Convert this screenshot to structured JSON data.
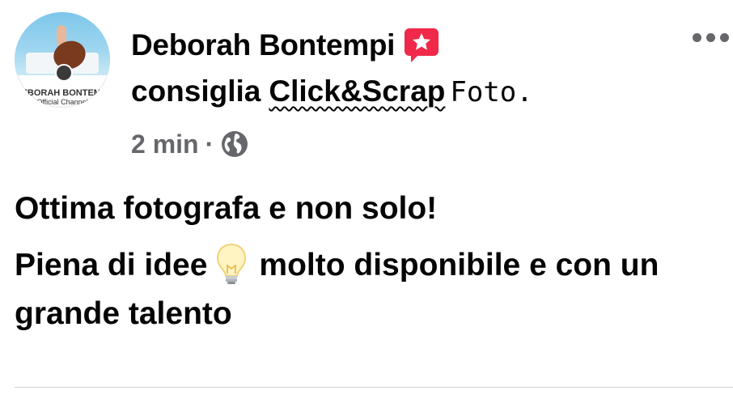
{
  "post": {
    "author": {
      "name": "Deborah Bontempi",
      "avatar_name": "DEBORAH BONTEMPI",
      "avatar_sub": "Official Channel"
    },
    "recommendation": {
      "verb": "consiglia",
      "page_name": "Click&Scrap",
      "page_suffix": "Foto."
    },
    "meta": {
      "time": "2 min",
      "separator": "·",
      "audience_icon": "globe-icon"
    },
    "body": {
      "line1": "Ottima fotografa e non solo!",
      "line2_part1": "Piena di idee",
      "line2_emoji": "light-bulb-icon",
      "line2_part2": "molto disponibile e con un grande talento"
    },
    "icons": {
      "recommend": "recommend-star-icon",
      "more": "more-options-icon"
    },
    "colors": {
      "recommend_red": "#f02849",
      "secondary_text": "#65676b",
      "primary_text": "#050505"
    }
  }
}
